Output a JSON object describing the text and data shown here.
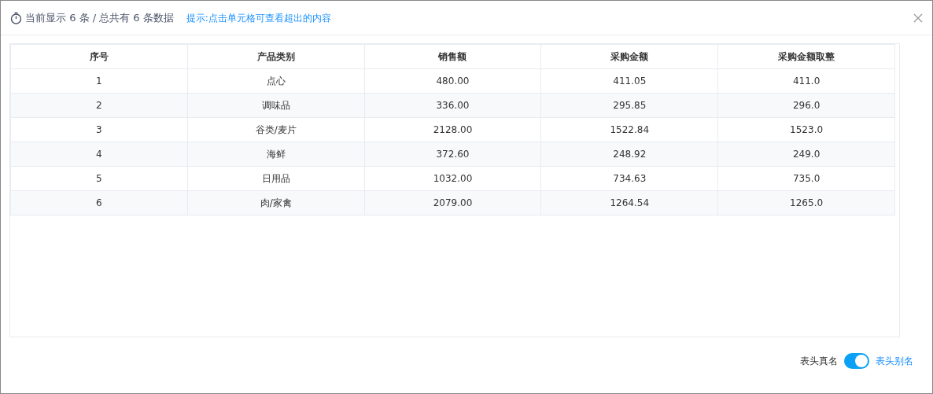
{
  "dialog": {
    "title": "当前显示 6 条 / 总共有 6 条数据",
    "hint": "提示:点击单元格可查看超出的内容"
  },
  "table": {
    "columns": [
      "序号",
      "产品类别",
      "销售额",
      "采购金额",
      "采购金额取整"
    ],
    "rows": [
      [
        "1",
        "点心",
        "480.00",
        "411.05",
        "411.0"
      ],
      [
        "2",
        "调味品",
        "336.00",
        "295.85",
        "296.0"
      ],
      [
        "3",
        "谷类/麦片",
        "2128.00",
        "1522.84",
        "1523.0"
      ],
      [
        "4",
        "海鲜",
        "372.60",
        "248.92",
        "249.0"
      ],
      [
        "5",
        "日用品",
        "1032.00",
        "734.63",
        "735.0"
      ],
      [
        "6",
        "肉/家禽",
        "2079.00",
        "1264.54",
        "1265.0"
      ]
    ]
  },
  "header_switch": {
    "off_label": "表头真名",
    "on_label": "表头别名",
    "on": true
  }
}
